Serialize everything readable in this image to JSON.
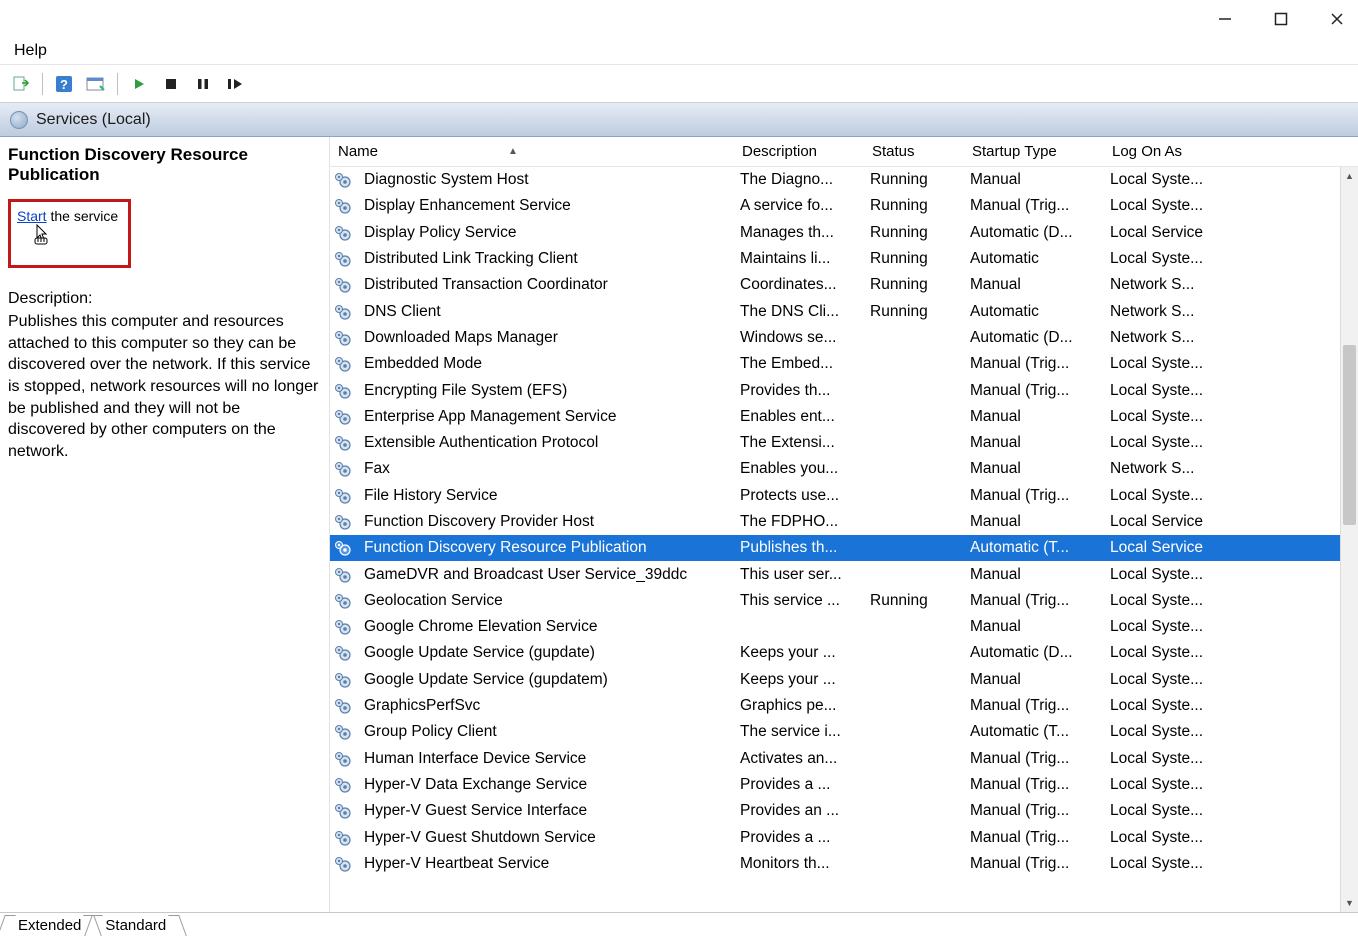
{
  "menubar": {
    "help": "Help"
  },
  "tabbar": {
    "label": "Services (Local)"
  },
  "leftpane": {
    "selected_service": "Function Discovery Resource Publication",
    "action_link": "Start",
    "action_rest": " the service",
    "description_label": "Description:",
    "description": "Publishes this computer and resources attached to this computer so they can be discovered over the network.  If this service is stopped, network resources will no longer be published and they will not be discovered by other computers on the network."
  },
  "columns": {
    "name": "Name",
    "description": "Description",
    "status": "Status",
    "startup": "Startup Type",
    "logon": "Log On As"
  },
  "bottom_tabs": {
    "extended": "Extended",
    "standard": "Standard"
  },
  "services": [
    {
      "name": "Diagnostic System Host",
      "desc": "The Diagno...",
      "status": "Running",
      "startup": "Manual",
      "logon": "Local Syste..."
    },
    {
      "name": "Display Enhancement Service",
      "desc": "A service fo...",
      "status": "Running",
      "startup": "Manual (Trig...",
      "logon": "Local Syste..."
    },
    {
      "name": "Display Policy Service",
      "desc": "Manages th...",
      "status": "Running",
      "startup": "Automatic (D...",
      "logon": "Local Service"
    },
    {
      "name": "Distributed Link Tracking Client",
      "desc": "Maintains li...",
      "status": "Running",
      "startup": "Automatic",
      "logon": "Local Syste..."
    },
    {
      "name": "Distributed Transaction Coordinator",
      "desc": "Coordinates...",
      "status": "Running",
      "startup": "Manual",
      "logon": "Network S..."
    },
    {
      "name": "DNS Client",
      "desc": "The DNS Cli...",
      "status": "Running",
      "startup": "Automatic",
      "logon": "Network S..."
    },
    {
      "name": "Downloaded Maps Manager",
      "desc": "Windows se...",
      "status": "",
      "startup": "Automatic (D...",
      "logon": "Network S..."
    },
    {
      "name": "Embedded Mode",
      "desc": "The Embed...",
      "status": "",
      "startup": "Manual (Trig...",
      "logon": "Local Syste..."
    },
    {
      "name": "Encrypting File System (EFS)",
      "desc": "Provides th...",
      "status": "",
      "startup": "Manual (Trig...",
      "logon": "Local Syste..."
    },
    {
      "name": "Enterprise App Management Service",
      "desc": "Enables ent...",
      "status": "",
      "startup": "Manual",
      "logon": "Local Syste..."
    },
    {
      "name": "Extensible Authentication Protocol",
      "desc": "The Extensi...",
      "status": "",
      "startup": "Manual",
      "logon": "Local Syste..."
    },
    {
      "name": "Fax",
      "desc": "Enables you...",
      "status": "",
      "startup": "Manual",
      "logon": "Network S..."
    },
    {
      "name": "File History Service",
      "desc": "Protects use...",
      "status": "",
      "startup": "Manual (Trig...",
      "logon": "Local Syste..."
    },
    {
      "name": "Function Discovery Provider Host",
      "desc": "The FDPHO...",
      "status": "",
      "startup": "Manual",
      "logon": "Local Service"
    },
    {
      "name": "Function Discovery Resource Publication",
      "desc": "Publishes th...",
      "status": "",
      "startup": "Automatic (T...",
      "logon": "Local Service",
      "selected": true
    },
    {
      "name": "GameDVR and Broadcast User Service_39ddc",
      "desc": "This user ser...",
      "status": "",
      "startup": "Manual",
      "logon": "Local Syste..."
    },
    {
      "name": "Geolocation Service",
      "desc": "This service ...",
      "status": "Running",
      "startup": "Manual (Trig...",
      "logon": "Local Syste..."
    },
    {
      "name": "Google Chrome Elevation Service",
      "desc": "",
      "status": "",
      "startup": "Manual",
      "logon": "Local Syste..."
    },
    {
      "name": "Google Update Service (gupdate)",
      "desc": "Keeps your ...",
      "status": "",
      "startup": "Automatic (D...",
      "logon": "Local Syste..."
    },
    {
      "name": "Google Update Service (gupdatem)",
      "desc": "Keeps your ...",
      "status": "",
      "startup": "Manual",
      "logon": "Local Syste..."
    },
    {
      "name": "GraphicsPerfSvc",
      "desc": "Graphics pe...",
      "status": "",
      "startup": "Manual (Trig...",
      "logon": "Local Syste..."
    },
    {
      "name": "Group Policy Client",
      "desc": "The service i...",
      "status": "",
      "startup": "Automatic (T...",
      "logon": "Local Syste..."
    },
    {
      "name": "Human Interface Device Service",
      "desc": "Activates an...",
      "status": "",
      "startup": "Manual (Trig...",
      "logon": "Local Syste..."
    },
    {
      "name": "Hyper-V Data Exchange Service",
      "desc": "Provides a ...",
      "status": "",
      "startup": "Manual (Trig...",
      "logon": "Local Syste..."
    },
    {
      "name": "Hyper-V Guest Service Interface",
      "desc": "Provides an ...",
      "status": "",
      "startup": "Manual (Trig...",
      "logon": "Local Syste..."
    },
    {
      "name": "Hyper-V Guest Shutdown Service",
      "desc": "Provides a ...",
      "status": "",
      "startup": "Manual (Trig...",
      "logon": "Local Syste..."
    },
    {
      "name": "Hyper-V Heartbeat Service",
      "desc": "Monitors th...",
      "status": "",
      "startup": "Manual (Trig...",
      "logon": "Local Syste..."
    }
  ]
}
